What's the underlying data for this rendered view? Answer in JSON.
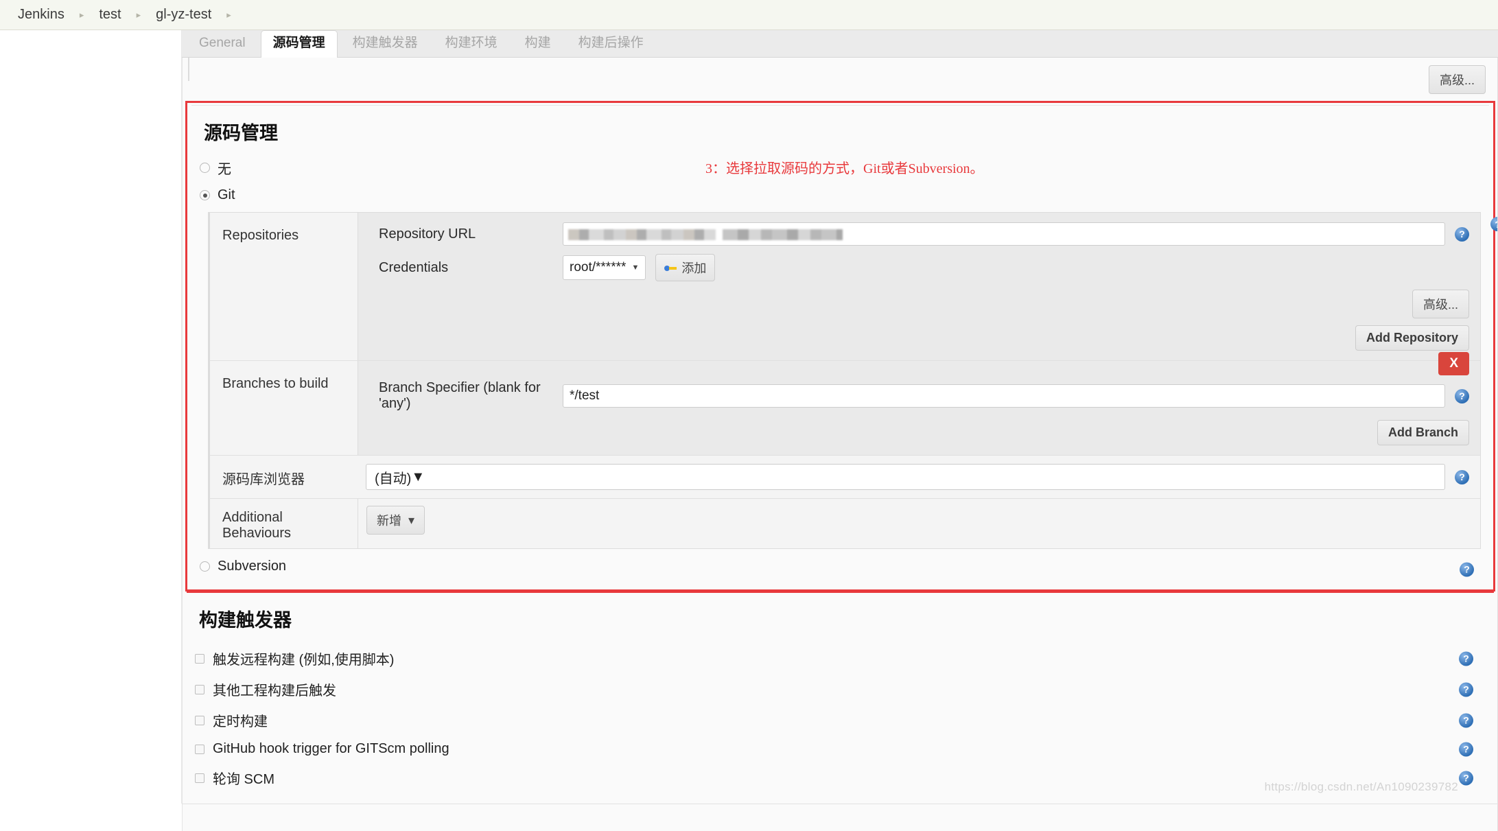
{
  "breadcrumb": {
    "items": [
      "Jenkins",
      "test",
      "gl-yz-test"
    ],
    "separator": "▸"
  },
  "tabs": [
    {
      "label": "General",
      "active": false
    },
    {
      "label": "源码管理",
      "active": true
    },
    {
      "label": "构建触发器",
      "active": false
    },
    {
      "label": "构建环境",
      "active": false
    },
    {
      "label": "构建",
      "active": false
    },
    {
      "label": "构建后操作",
      "active": false
    }
  ],
  "top": {
    "advanced_button": "高级..."
  },
  "scm": {
    "title": "源码管理",
    "annotation": "3：选择拉取源码的方式，Git或者Subversion。",
    "annotation_color": "#e8393c",
    "options": [
      {
        "label": "无",
        "selected": false
      },
      {
        "label": "Git",
        "selected": true
      },
      {
        "label": "Subversion",
        "selected": false
      }
    ],
    "repositories": {
      "label": "Repositories",
      "repository_url_label": "Repository URL",
      "repository_url_value": "",
      "repository_url_redacted": true,
      "credentials_label": "Credentials",
      "credentials_value": "root/******",
      "add_credentials_button": "添加",
      "advanced_button": "高级...",
      "add_repository_button": "Add Repository"
    },
    "branches": {
      "label": "Branches to build",
      "branch_specifier_label": "Branch Specifier (blank for 'any')",
      "branch_specifier_value": "*/test",
      "delete_button": "X",
      "add_branch_button": "Add Branch"
    },
    "repo_browser": {
      "label": "源码库浏览器",
      "value": "(自动)"
    },
    "additional_behaviours": {
      "label": "Additional Behaviours",
      "add_button": "新增",
      "caret": "▾"
    }
  },
  "triggers": {
    "title": "构建触发器",
    "items": [
      {
        "label": "触发远程构建 (例如,使用脚本)",
        "checked": false
      },
      {
        "label": "其他工程构建后触发",
        "checked": false
      },
      {
        "label": "定时构建",
        "checked": false
      },
      {
        "label": "GitHub hook trigger for GITScm polling",
        "checked": false
      },
      {
        "label": "轮询 SCM",
        "checked": false
      }
    ]
  },
  "help_icon_glyph": "?",
  "watermark": "https://blog.csdn.net/An1090239782"
}
